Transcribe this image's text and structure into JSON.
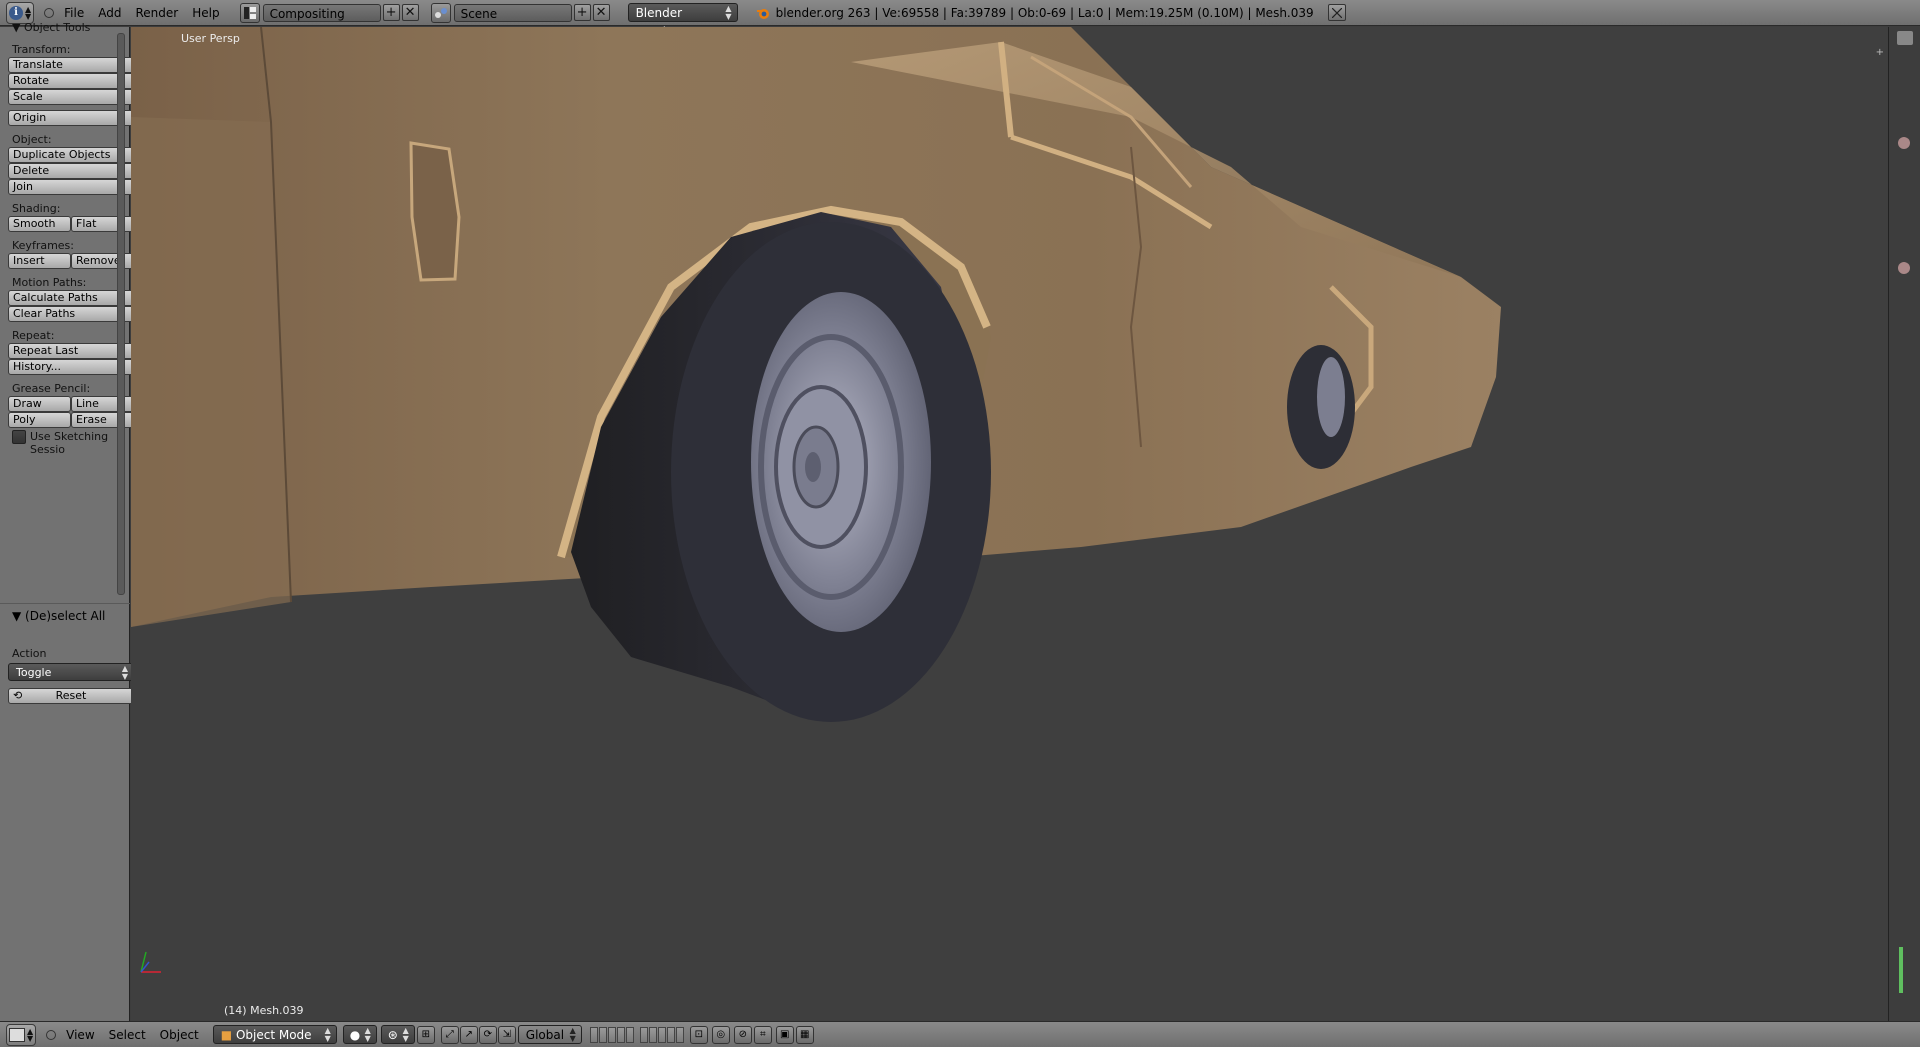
{
  "top_header": {
    "menus": [
      "File",
      "Add",
      "Render",
      "Help"
    ],
    "screen_layout": "Compositing",
    "scene": "Scene",
    "render_engine": "Blender Render",
    "stats": "blender.org 263 | Ve:69558 | Fa:39789 | Ob:0-69 | La:0 | Mem:19.25M (0.10M) | Mesh.039"
  },
  "tool_shelf": {
    "panel_title": "Object Tools",
    "transform_label": "Transform:",
    "translate": "Translate",
    "rotate": "Rotate",
    "scale": "Scale",
    "origin": "Origin",
    "object_label": "Object:",
    "duplicate": "Duplicate Objects",
    "delete": "Delete",
    "join": "Join",
    "shading_label": "Shading:",
    "smooth": "Smooth",
    "flat": "Flat",
    "keyframes_label": "Keyframes:",
    "insert": "Insert",
    "remove": "Remove",
    "motion_paths_label": "Motion Paths:",
    "calculate_paths": "Calculate Paths",
    "clear_paths": "Clear Paths",
    "repeat_label": "Repeat:",
    "repeat_last": "Repeat Last",
    "history": "History...",
    "grease_pencil_label": "Grease Pencil:",
    "draw": "Draw",
    "line": "Line",
    "poly": "Poly",
    "erase": "Erase",
    "use_sketching": "Use Sketching Sessio"
  },
  "operator_panel": {
    "title": "(De)select All",
    "action_label": "Action",
    "action_value": "Toggle",
    "reset": "Reset"
  },
  "viewport": {
    "view_name": "User Persp",
    "object_info": "(14) Mesh.039"
  },
  "bottom_header": {
    "menus": [
      "View",
      "Select",
      "Object"
    ],
    "mode": "Object Mode",
    "orientation": "Global"
  },
  "colors": {
    "header_bg": "#7c7c7c",
    "panel_bg": "#727272",
    "viewport_bg": "#3f3f3f",
    "car_body": "#8c7456",
    "tire": "#2a2a30",
    "rim": "#7e7f92"
  }
}
